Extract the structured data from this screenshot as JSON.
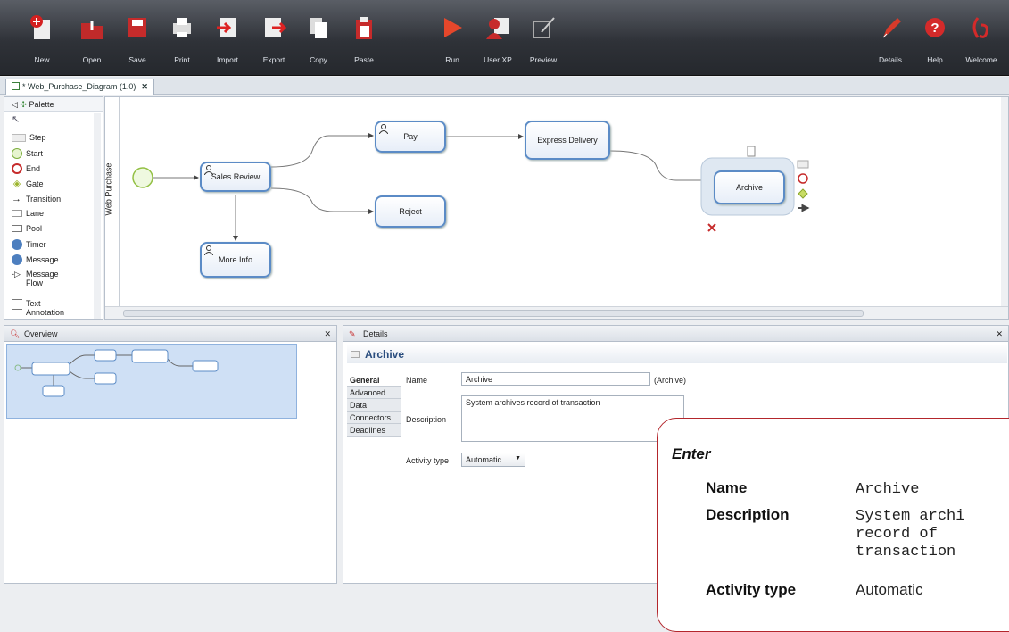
{
  "toolbar": {
    "buttons": [
      {
        "label": "New",
        "icon": "new-icon"
      },
      {
        "label": "Open",
        "icon": "open-icon"
      },
      {
        "label": "Save",
        "icon": "save-icon"
      },
      {
        "label": "Print",
        "icon": "print-icon"
      },
      {
        "label": "Import",
        "icon": "import-icon"
      },
      {
        "label": "Export",
        "icon": "export-icon"
      },
      {
        "label": "Copy",
        "icon": "copy-icon"
      },
      {
        "label": "Paste",
        "icon": "paste-icon"
      },
      {
        "label": "Run",
        "icon": "run-icon"
      },
      {
        "label": "User XP",
        "icon": "user-xp-icon"
      },
      {
        "label": "Preview",
        "icon": "preview-icon"
      },
      {
        "label": "Details",
        "icon": "details-icon"
      },
      {
        "label": "Help",
        "icon": "help-icon"
      },
      {
        "label": "Welcome",
        "icon": "welcome-icon"
      }
    ]
  },
  "tab": {
    "title": "* Web_Purchase_Diagram (1.0)",
    "close": "✕"
  },
  "palette": {
    "title": "Palette",
    "items": [
      "Step",
      "Start",
      "End",
      "Gate",
      "Transition",
      "Lane",
      "Pool",
      "Timer",
      "Message",
      "Message Flow",
      "Text Annotation"
    ]
  },
  "diagram": {
    "lane": "Web Purchase",
    "nodes": {
      "sales_review": "Sales Review",
      "pay": "Pay",
      "reject": "Reject",
      "more_info": "More Info",
      "express_delivery": "Express Delivery",
      "archive": "Archive"
    }
  },
  "overview": {
    "title": "Overview",
    "close": "✕"
  },
  "details": {
    "title": "Details",
    "close": "✕",
    "object_name": "Archive",
    "tabs": [
      "General",
      "Advanced",
      "Data",
      "Connectors",
      "Deadlines"
    ],
    "name_label": "Name",
    "name_value": "Archive",
    "name_suffix": "(Archive)",
    "description_label": "Description",
    "description_value": "System archives record of transaction",
    "activity_type_label": "Activity type",
    "activity_type_value": "Automatic"
  },
  "callout": {
    "title": "Enter",
    "rows": [
      {
        "label": "Name",
        "value": "Archive"
      },
      {
        "label": "Description",
        "value": "System archi\nrecord of\ntransaction"
      },
      {
        "label": "Activity type",
        "value": "Automatic"
      }
    ]
  },
  "colors": {
    "accent": "#5b8bc6",
    "callout_border": "#b3262c",
    "toolbar_dark": "#2f3238"
  }
}
